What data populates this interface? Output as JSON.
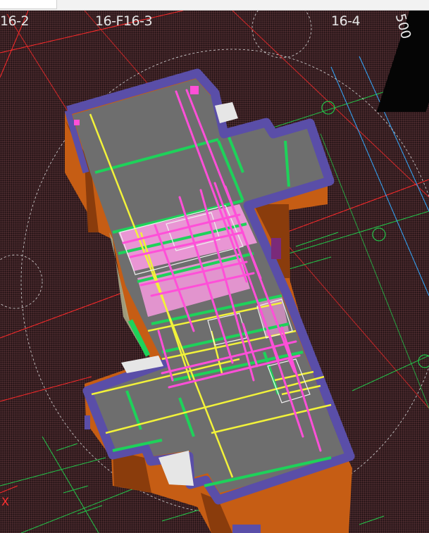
{
  "window": {
    "title": ""
  },
  "grid_axes": {
    "left": "16-2",
    "center": "16-F16-3",
    "right": "16-4",
    "corner": "500"
  },
  "markers": {
    "origin_mark": "X"
  },
  "colors": {
    "background": "#3a1e22",
    "wall_top": "#5a4ea8",
    "wall_side": "#c65d14",
    "slab": "#6e6e6e",
    "beam_yellow": "#f2f23a",
    "beam_green": "#1ed25a",
    "pipe_magenta": "#ff4fd8",
    "grid_red": "#ff2a2a",
    "grid_green": "#22c84a",
    "grid_blue": "#33aaff"
  },
  "icons": {
    "axis_bubble": "circle-icon",
    "x_marker": "x-mark-icon"
  }
}
